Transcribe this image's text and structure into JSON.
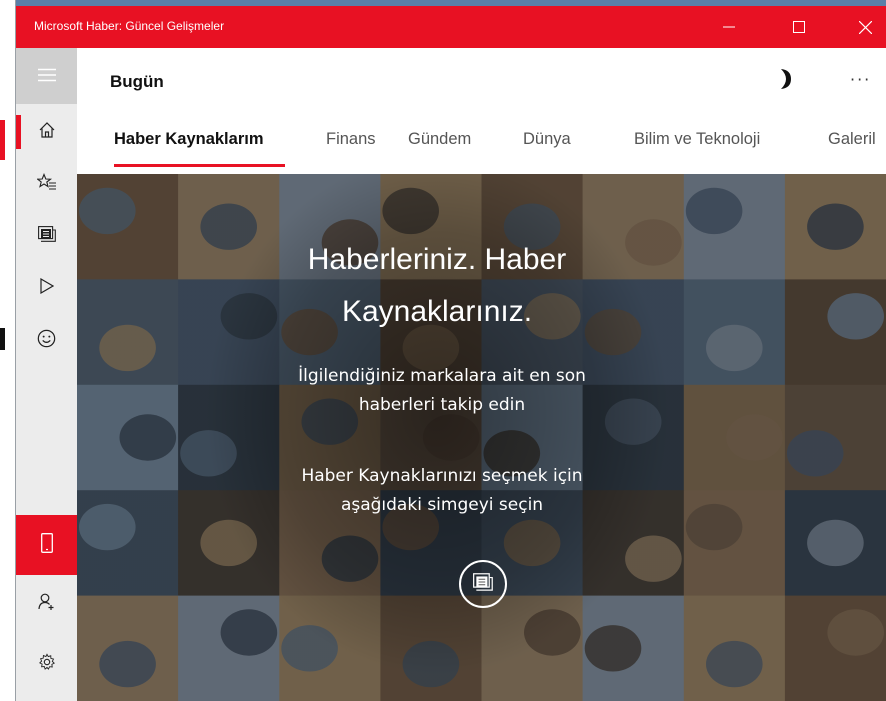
{
  "window": {
    "title": "Microsoft Haber: Güncel Gelişmeler",
    "accent_color": "#e81123",
    "controls": [
      "minimize-icon",
      "maximize-icon",
      "close-icon"
    ]
  },
  "header": {
    "title": "Bugün",
    "icons": [
      "moon-icon",
      "more-icon"
    ],
    "more_label": "···"
  },
  "tabs": [
    {
      "label": "Haber Kaynaklarım",
      "active": true
    },
    {
      "label": "Finans"
    },
    {
      "label": "Gündem"
    },
    {
      "label": "Dünya"
    },
    {
      "label": "Bilim ve Teknoloji"
    },
    {
      "label": "Galeril"
    }
  ],
  "sidebar": {
    "items": [
      {
        "icon": "hamburger-icon"
      },
      {
        "icon": "home-icon",
        "active": true
      },
      {
        "icon": "favorites-icon"
      },
      {
        "icon": "news-sources-icon"
      },
      {
        "icon": "video-icon"
      },
      {
        "icon": "smiley-icon"
      },
      {
        "icon": "phone-icon",
        "highlight": true
      },
      {
        "icon": "add-person-icon"
      },
      {
        "icon": "settings-icon"
      }
    ]
  },
  "hero": {
    "heading_line1": "Haberleriniz. Haber",
    "heading_line2": "Kaynaklarınız.",
    "subtitle_line1": "İlgilendiğiniz markalara ait en son",
    "subtitle_line2": "haberleri takip edin",
    "cta_line1": "Haber Kaynaklarınızı seçmek için",
    "cta_line2": "aşağıdaki simgeyi seçin",
    "button_icon": "news-sources-icon"
  }
}
